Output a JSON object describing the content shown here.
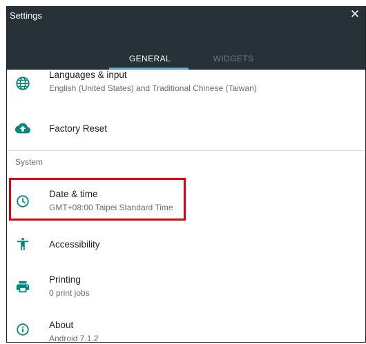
{
  "window": {
    "title": "Settings"
  },
  "tabs": [
    {
      "label": "GENERAL",
      "active": true
    },
    {
      "label": "WIDGETS",
      "active": false
    }
  ],
  "list": {
    "items": [
      {
        "title": "Languages & input",
        "subtitle": "English (United States) and Traditional Chinese (Taiwan)",
        "icon": "globe-icon"
      },
      {
        "title": "Factory Reset",
        "icon": "cloud-upload-icon"
      }
    ],
    "section_title": "System",
    "system_items": [
      {
        "title": "Date & time",
        "subtitle": "GMT+08:00 Taipei Standard Time",
        "icon": "clock-icon"
      },
      {
        "title": "Accessibility",
        "icon": "accessibility-icon"
      },
      {
        "title": "Printing",
        "subtitle": "0 print jobs",
        "icon": "printer-icon"
      },
      {
        "title": "About",
        "subtitle": "Android 7.1.2",
        "icon": "info-icon"
      }
    ]
  },
  "colors": {
    "header_bg": "#263238",
    "accent_teal": "#00897b",
    "highlight_red": "#e8000b",
    "tab_indicator": "#5fa7c9"
  }
}
